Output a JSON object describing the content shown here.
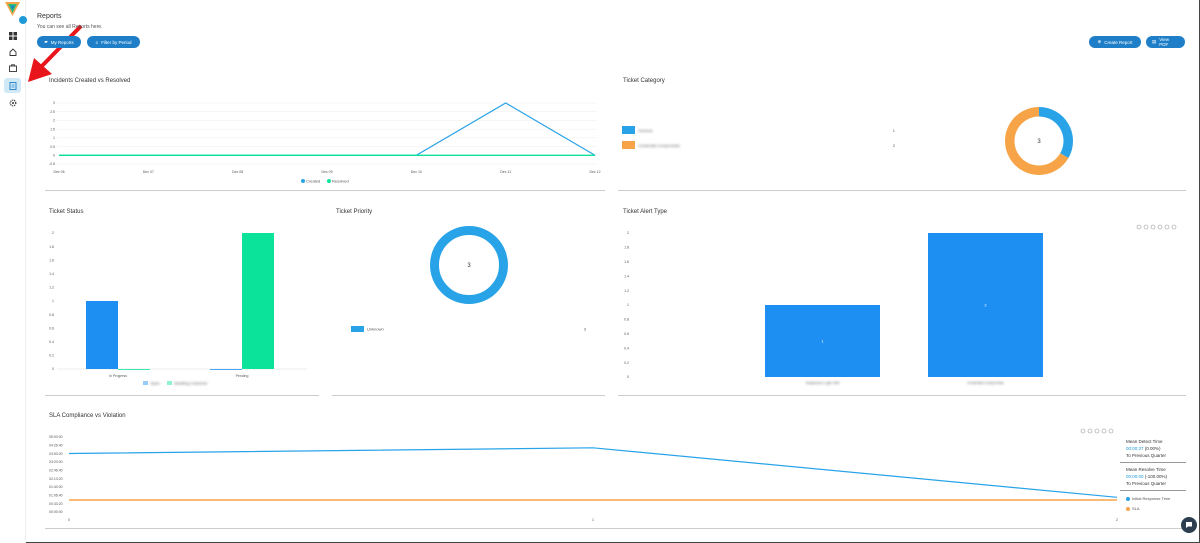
{
  "page": {
    "title": "Reports",
    "subtitle": "You can see all Reports here."
  },
  "toolbar": {
    "my_reports": "My Reports",
    "filter_period": "Filter by Period",
    "create_report": "Create Report",
    "view_pdf": "View PDF"
  },
  "sidebar": {
    "items": [
      "dashboard-icon",
      "home-icon",
      "tickets-icon",
      "reports-icon",
      "settings-icon"
    ]
  },
  "colors": {
    "accent": "#1e7fc8",
    "blue": "#29a3e8",
    "green": "#0be39a",
    "orange": "#f6a447",
    "bar_blue": "#1e8ff2"
  },
  "incidents": {
    "title": "Incidents Created vs Resolved",
    "y_ticks": [
      "3",
      "2.5",
      "2",
      "1.5",
      "1",
      "0.5",
      "0",
      "-0.5"
    ],
    "x_ticks": [
      "Dec 06",
      "Dec 07",
      "Dec 08",
      "Dec 09",
      "Dec 10",
      "Dec 11",
      "Dec 12"
    ],
    "legend": [
      "Created",
      "Resolved"
    ],
    "chart_data": {
      "type": "line",
      "categories": [
        "Dec 06",
        "Dec 07",
        "Dec 08",
        "Dec 09",
        "Dec 10",
        "Dec 11",
        "Dec 12"
      ],
      "series": [
        {
          "name": "Created",
          "values": [
            0,
            0,
            0,
            0,
            0,
            3,
            0
          ]
        },
        {
          "name": "Resolved",
          "values": [
            0,
            0,
            0,
            0,
            0,
            0,
            0
          ]
        }
      ]
    }
  },
  "category": {
    "title": "Ticket Category",
    "rows": [
      {
        "label": "General",
        "value": "1"
      },
      {
        "label": "Credential Compromise",
        "value": "2"
      }
    ],
    "center": "3",
    "chart_data": {
      "type": "pie",
      "values": [
        1,
        2
      ]
    }
  },
  "status": {
    "title": "Ticket Status",
    "y_ticks": [
      "2",
      "1.8",
      "1.6",
      "1.4",
      "1.2",
      "1",
      "0.8",
      "0.6",
      "0.4",
      "0.2",
      "0"
    ],
    "x_ticks": [
      "In Progress",
      "Pending"
    ],
    "legend": [
      "Open",
      "Awaiting Customer"
    ],
    "chart_data": {
      "type": "bar",
      "categories": [
        "In Progress",
        "Pending"
      ],
      "series": [
        {
          "name": "Open",
          "values": [
            1,
            0
          ]
        },
        {
          "name": "Awaiting Customer",
          "values": [
            0,
            2
          ]
        }
      ],
      "ylim": [
        0,
        2
      ]
    }
  },
  "priority": {
    "title": "Ticket Priority",
    "center": "3",
    "rows": [
      {
        "label": "Unknown",
        "value": "3"
      }
    ],
    "chart_data": {
      "type": "pie",
      "values": [
        3
      ]
    }
  },
  "alert": {
    "title": "Ticket Alert Type",
    "y_ticks": [
      "2",
      "1.8",
      "1.6",
      "1.4",
      "1.2",
      "1",
      "0.8",
      "0.6",
      "0.4",
      "0.2",
      "0"
    ],
    "x_ticks": [
      "Suspicious Login Test",
      "Credential Compromise"
    ],
    "chart_data": {
      "type": "bar",
      "categories": [
        "Suspicious Login Test",
        "Credential Compromise"
      ],
      "values": [
        1,
        2
      ],
      "ylim": [
        0,
        2
      ]
    }
  },
  "sla": {
    "title": "SLA Compliance vs Violation",
    "y_ticks": [
      "05:00:00",
      "04:26:40",
      "03:53:20",
      "03:20:00",
      "02:46:40",
      "02:13:20",
      "01:40:00",
      "01:06:40",
      "00:33:20",
      "00:00:00"
    ],
    "x_ticks": [
      "0",
      "1",
      "2"
    ],
    "legend": [
      "Initial Response Time",
      "SLA"
    ],
    "mean_detect_title": "Mean Detect Time",
    "mean_detect_value": "00:00:37",
    "mean_detect_pct": " (0.00%)",
    "mean_detect_note": "To Previous Quarter",
    "mean_resolve_title": "Mean Resolve Time",
    "mean_resolve_value": "00:00:00",
    "mean_resolve_pct": " (-100.00%)",
    "mean_resolve_note": "To Previous Quarter",
    "chart_data": {
      "type": "line",
      "x": [
        0,
        1,
        2
      ],
      "series": [
        {
          "name": "Initial Response Time",
          "values": [
            3.9,
            4.28,
            0.98
          ]
        },
        {
          "name": "SLA",
          "values": [
            0,
            0,
            0
          ]
        }
      ]
    }
  }
}
